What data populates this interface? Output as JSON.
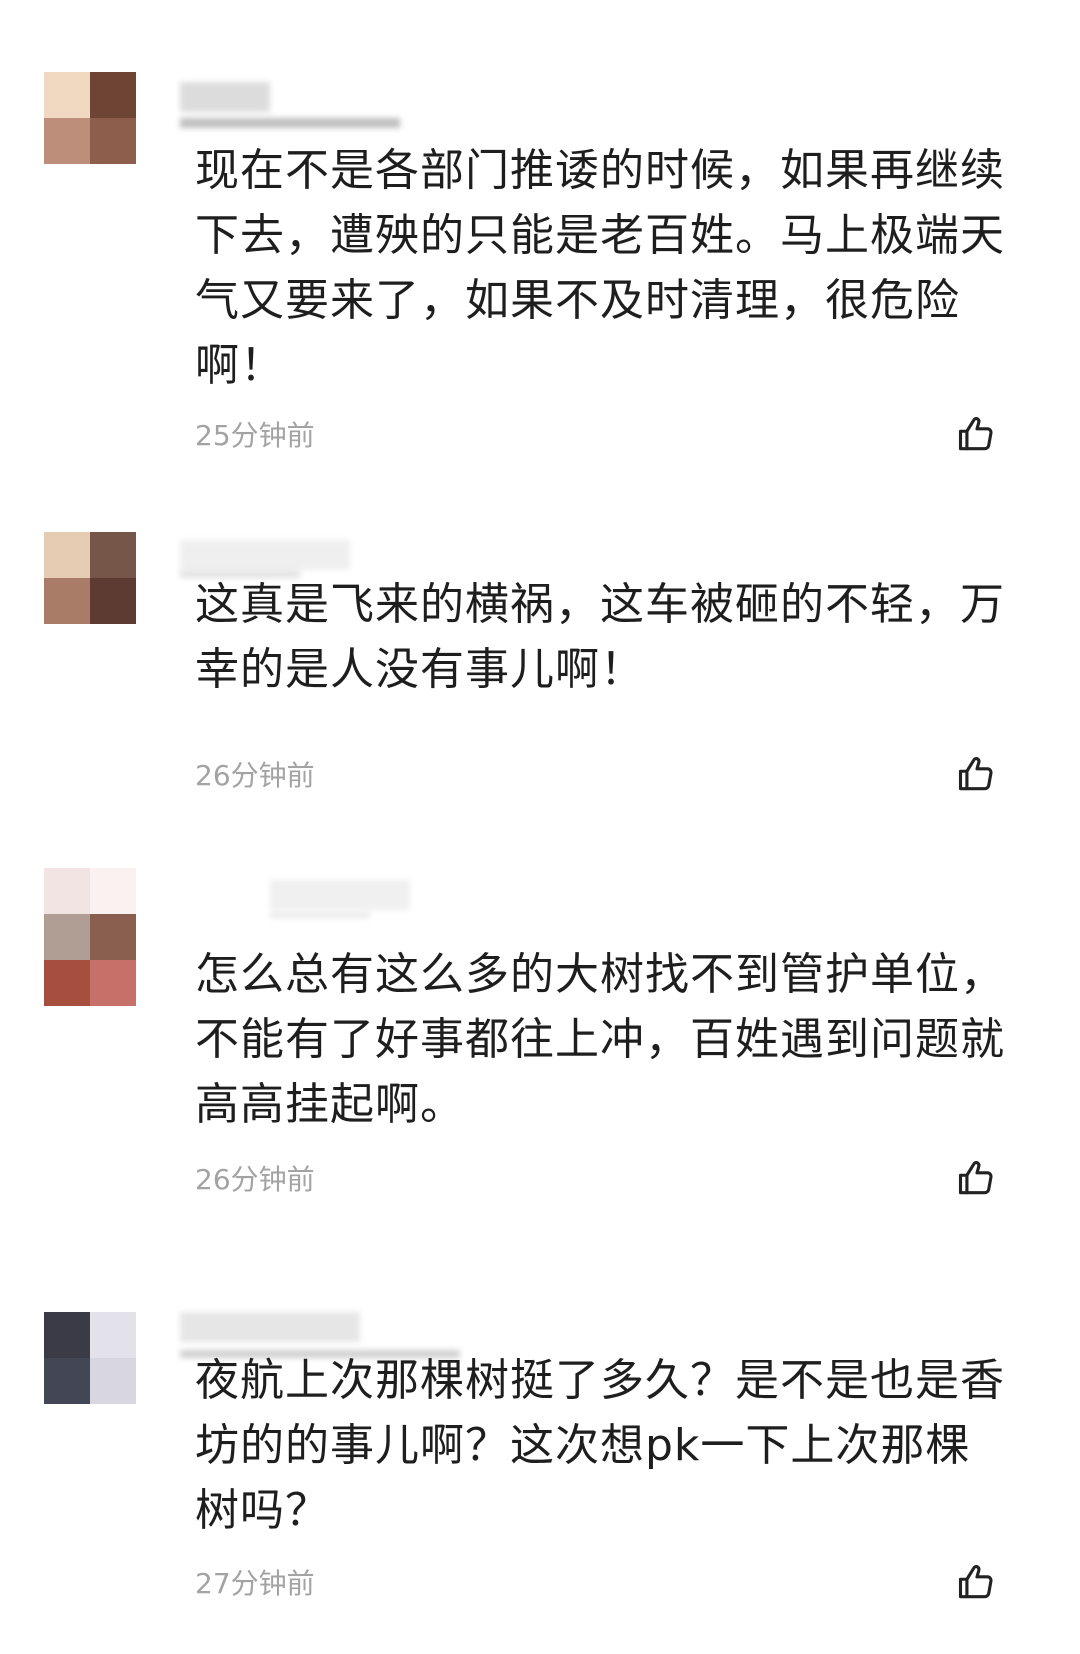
{
  "comments": [
    {
      "text": "现在不是各部门推诿的时候，如果再继续下去，遭殃的只能是老百姓。马上极端天气又要来了，如果不及时清理，很危险啊！",
      "time": "25分钟前",
      "like_icon": "thumbs-up-icon",
      "avatar_colors": [
        "#f0d9c0",
        "#6e4535",
        "#bd8f7a",
        "#8e5e4d"
      ],
      "name_blur_colors": [
        "#dcdcdc",
        "#bfbfbf"
      ]
    },
    {
      "text": "这真是飞来的横祸，这车被砸的不轻，万幸的是人没有事儿啊！",
      "time": "26分钟前",
      "like_icon": "thumbs-up-icon",
      "avatar_colors": [
        "#e6ccb2",
        "#765649",
        "#a97c68",
        "#5e3b32"
      ],
      "name_blur_colors": [
        "#efefef",
        "#e2e2e2"
      ]
    },
    {
      "text": "怎么总有这么多的大树找不到管护单位，不能有了好事都往上冲，百姓遇到问题就高高挂起啊。",
      "time": "26分钟前",
      "like_icon": "thumbs-up-icon",
      "avatar_colors": [
        "#f3e4e4",
        "#fbf1f1",
        "#b09d93",
        "#8a5f4f",
        "#a64f3f",
        "#c77069"
      ],
      "name_blur_colors": [
        "#f0f0f0",
        "#e9e9e9"
      ]
    },
    {
      "text": "夜航上次那棵树挺了多久？是不是也是香坊的的事儿啊？这次想pk一下上次那棵树吗？",
      "time": "27分钟前",
      "like_icon": "thumbs-up-icon",
      "avatar_colors": [
        "#3a3b47",
        "#e3e2ea",
        "#434654",
        "#d8d6e0"
      ],
      "name_blur_colors": [
        "#e6e6e6",
        "#d0d0d0"
      ]
    }
  ]
}
